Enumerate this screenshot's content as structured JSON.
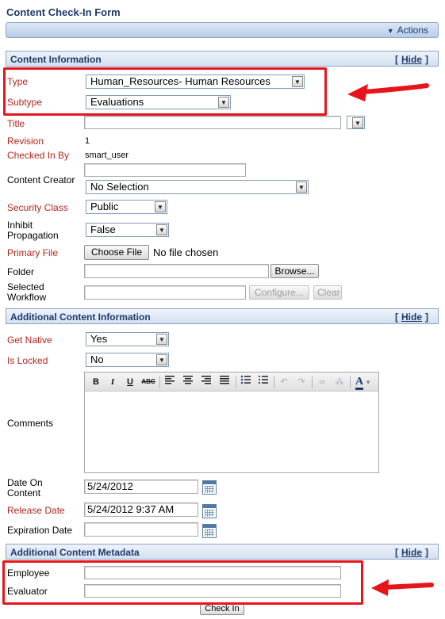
{
  "page": {
    "title": "Content Check-In Form"
  },
  "actionbar": {
    "label": "Actions"
  },
  "sections": {
    "content_info": {
      "title": "Content Information",
      "hide_label": "Hide"
    },
    "additional_info": {
      "title": "Additional Content Information",
      "hide_label": "Hide"
    },
    "metadata": {
      "title": "Additional Content Metadata",
      "hide_label": "Hide"
    }
  },
  "fields": {
    "type": {
      "label": "Type",
      "value": "Human_Resources- Human Resources"
    },
    "subtype": {
      "label": "Subtype",
      "value": "Evaluations"
    },
    "title": {
      "label": "Title",
      "value": ""
    },
    "revision": {
      "label": "Revision",
      "value": "1"
    },
    "checked_in_by": {
      "label": "Checked In By",
      "value": "smart_user"
    },
    "content_creator": {
      "label": "Content Creator",
      "text": "",
      "value": "No Selection"
    },
    "security_class": {
      "label": "Security Class",
      "value": "Public"
    },
    "inhibit_propagation": {
      "label_line1": "Inhibit",
      "label_line2": "Propagation",
      "value": "False"
    },
    "primary_file": {
      "label": "Primary File",
      "button": "Choose File",
      "status": "No file chosen"
    },
    "folder": {
      "label": "Folder",
      "button": "Browse..."
    },
    "selected_workflow": {
      "label_line1": "Selected",
      "label_line2": "Workflow",
      "configure_button": "Configure...",
      "clear_button": "Clear"
    },
    "get_native": {
      "label": "Get Native",
      "value": "Yes"
    },
    "is_locked": {
      "label": "Is Locked",
      "value": "No"
    },
    "comments": {
      "label": "Comments"
    },
    "date_on_content": {
      "label_line1": "Date On",
      "label_line2": "Content",
      "value": "5/24/2012"
    },
    "release_date": {
      "label": "Release Date",
      "value": "5/24/2012 9:37 AM"
    },
    "expiration_date": {
      "label": "Expiration Date",
      "value": ""
    },
    "employee": {
      "label": "Employee",
      "value": ""
    },
    "evaluator": {
      "label": "Evaluator",
      "value": ""
    }
  },
  "editor_toolbar": {
    "bold": "B",
    "italic": "I",
    "underline": "U",
    "strike": "ABC",
    "font_color": "A"
  },
  "footer": {
    "checkin_label": "Check In"
  },
  "colors": {
    "annotation_red": "#e8141b",
    "header_blue": "#1f3a6b",
    "required_label": "#b3261e"
  }
}
